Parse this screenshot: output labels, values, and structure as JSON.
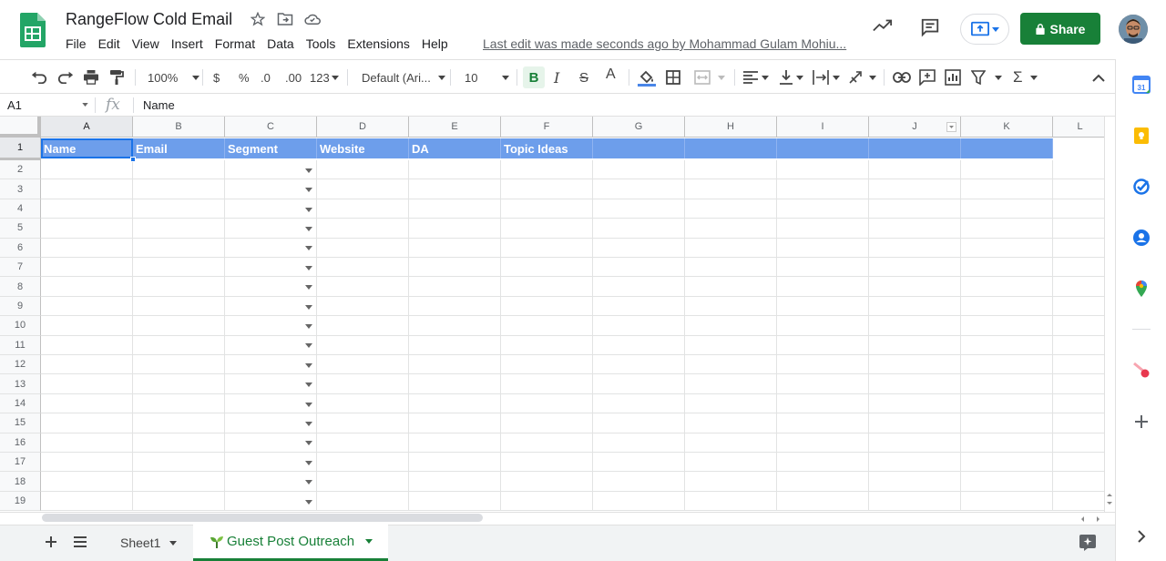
{
  "app": {
    "doc_title": "RangeFlow Cold Email",
    "last_edit": "Last edit was made seconds ago by Mohammad Gulam Mohiu...",
    "share_label": "Share"
  },
  "menu": [
    "File",
    "Edit",
    "View",
    "Insert",
    "Format",
    "Data",
    "Tools",
    "Extensions",
    "Help"
  ],
  "toolbar": {
    "zoom": "100%",
    "currency": "$",
    "percent": "%",
    "decrease_decimal": ".0",
    "increase_decimal": ".00",
    "more_formats": "123",
    "font": "Default (Ari...",
    "font_size": "10",
    "bold": "B",
    "italic": "I",
    "strike": "S",
    "text_color": "A",
    "function": "Σ"
  },
  "formula_bar": {
    "name_box": "A1",
    "fx": "fx",
    "value": "Name"
  },
  "columns": [
    "A",
    "B",
    "C",
    "D",
    "E",
    "F",
    "G",
    "H",
    "I",
    "J",
    "K",
    "L"
  ],
  "rows": [
    "1",
    "2",
    "3",
    "4",
    "5",
    "6",
    "7",
    "8",
    "9",
    "10",
    "11",
    "12",
    "13",
    "14",
    "15",
    "16",
    "17",
    "18",
    "19"
  ],
  "header_row": [
    "Name",
    "Email",
    "Segment",
    "Website",
    "DA",
    "Topic Ideas",
    "",
    "",
    "",
    "",
    ""
  ],
  "sheets": {
    "sheet1": "Sheet1",
    "active": "Guest Post Outreach"
  },
  "colors": {
    "header_fill": "#6d9eeb",
    "share_green": "#188038",
    "active_tab_text": "#188038"
  }
}
